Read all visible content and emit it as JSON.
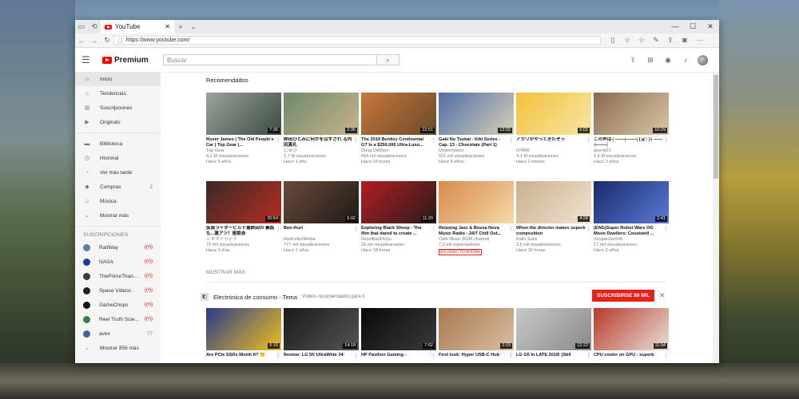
{
  "browser": {
    "tab_title": "YouTube",
    "url": "https://www.youtube.com/"
  },
  "masthead": {
    "logo_text": "Premium",
    "search_placeholder": "Buscar"
  },
  "sidebar": {
    "main_items": [
      {
        "label": "Inicio",
        "icon": "home-icon",
        "glyph": "⌂"
      },
      {
        "label": "Tendencias",
        "icon": "flame-icon",
        "glyph": "♨"
      },
      {
        "label": "Suscripciones",
        "icon": "subscriptions-icon",
        "glyph": "▤"
      },
      {
        "label": "Originals",
        "icon": "originals-icon",
        "glyph": "▶"
      }
    ],
    "library_items": [
      {
        "label": "Biblioteca",
        "icon": "folder-icon",
        "glyph": "▬",
        "count": ""
      },
      {
        "label": "Historial",
        "icon": "history-icon",
        "glyph": "◷",
        "count": ""
      },
      {
        "label": "Ver más tarde",
        "icon": "watch-later-icon",
        "glyph": "◔",
        "count": ""
      },
      {
        "label": "Compras",
        "icon": "tag-icon",
        "glyph": "◆",
        "count": "2"
      },
      {
        "label": "Música",
        "icon": "music-icon",
        "glyph": "♫",
        "count": ""
      },
      {
        "label": "Mostrar más",
        "icon": "chevron-down-icon",
        "glyph": "⌄",
        "count": ""
      }
    ],
    "subs_heading": "SUSCRIPCIONES",
    "subscriptions": [
      {
        "label": "RailWay",
        "right": "((•))",
        "color": "#5b7ea5"
      },
      {
        "label": "NASA",
        "right": "((•))",
        "color": "#1d3f8a"
      },
      {
        "label": "ThePrimeThan...",
        "right": "((•))",
        "color": "#3a3a3a"
      },
      {
        "label": "Space Videos",
        "right": "((•))",
        "color": "#222222"
      },
      {
        "label": "GameChops",
        "right": "((•))",
        "color": "#111111"
      },
      {
        "label": "Reel Truth Scie...",
        "right": "((•))",
        "color": "#3e7d4a"
      },
      {
        "label": "avex",
        "right": "77",
        "color": "#4a5fa0"
      }
    ],
    "show_more_subs": "Mostrar 856 más"
  },
  "main": {
    "recommended_title": "Recomendados",
    "row1": [
      {
        "title": "Rover James | The Old People's Car | Top Gear |...",
        "channel": "Top Gear",
        "views": "6,2 M visualizaciones",
        "age": "Hace 5 años",
        "duration": "7:36",
        "c1": "#9aa39b",
        "c2": "#3e4a44"
      },
      {
        "title": "姉田ひとみに何かをはずされ る内田真礼",
        "channel": "じゅび",
        "views": "1,7 M visualizaciones",
        "age": "Hace 1 año",
        "duration": "2:36",
        "c1": "#6d8a6a",
        "c2": "#c9b38c"
      },
      {
        "title": "The 2019 Bentley Continental GT Is a $250,000 Ultra-Luxu...",
        "channel": "Doug DeMuro",
        "views": "664 mil visualizaciones",
        "age": "Hace 19 horas",
        "duration": "23:51",
        "c1": "#c7773c",
        "c2": "#6b4a2a"
      },
      {
        "title": "Gaki No Tsukai - Kiki Series - Cap. 13 - Chocolate (Part 1)",
        "channel": "Undertowers",
        "views": "621 mil visualizaciones",
        "age": "Hace 5 años",
        "duration": "13:02",
        "c1": "#4d6fa8",
        "c2": "#d9d0b4"
      },
      {
        "title": "アカリがやってきたぞっ",
        "channel": "OYARI",
        "views": "4,1 M visualizaciones",
        "age": "Hace 2 meses",
        "duration": "5:02",
        "c1": "#f2c13a",
        "c2": "#f7e7a4"
      },
      {
        "title": "この声は┤——┼——┤( ゚д゚ )┤——┼——┤",
        "channel": "gromit21",
        "views": "2,6 M visualizaciones",
        "age": "Hace 3 años",
        "duration": "10:29",
        "c1": "#8b6a52",
        "c2": "#d8c6a4"
      }
    ],
    "row2": [
      {
        "title": "仮面ライダービルド最終回の 裏話も...激アツ！座談会",
        "channel": "シネマトゥデイ",
        "views": "72 mil visualizaciones",
        "age": "Hace 3 días",
        "duration": "20:54",
        "c1": "#3a2a28",
        "c2": "#b42d1e",
        "live": false
      },
      {
        "title": "Ben-Hurt",
        "channel": "RedLetterMedia",
        "views": "777 mil visualizaciones",
        "age": "Hace 2 años",
        "duration": "6:02",
        "c1": "#6a4b3a",
        "c2": "#1e1a18",
        "live": false
      },
      {
        "title": "Exploring Black Sheep - The film that dared to create ...",
        "channel": "GoodBadFlicks",
        "views": "26 mil visualizaciones",
        "age": "Hace 18 horas",
        "duration": "11:20",
        "c1": "#b01f24",
        "c2": "#2a1a1a",
        "live": false
      },
      {
        "title": "Relaxing Jazz & Bossa Nova Music Radio - 24/7 Chill Out...",
        "channel": "Cafe Music BGM channel",
        "views": "7,2 mil espectadores",
        "age": "",
        "duration": "",
        "c1": "#d98a4c",
        "c2": "#f4d9a8",
        "live": true,
        "live_label": "EN DIRECTO AHORA"
      },
      {
        "title": "When the director makes superb composition",
        "channel": "Kaiki Subs",
        "views": "2,5 mil visualizaciones",
        "age": "Hace 16 horas",
        "duration": "4:24",
        "c1": "#c9b090",
        "c2": "#f1e3cf",
        "live": false
      },
      {
        "title": "(ENG)Super Robot Wars OG Moon Dwellers: Coustwell ...",
        "channel": "ZengarZenvolt",
        "views": "17 mil visualizaciones",
        "age": "Hace 2 años",
        "duration": "2:41",
        "c1": "#1a2a6a",
        "c2": "#5a7ad8",
        "live": false
      }
    ],
    "show_more": "MOSTRAR MÁS",
    "shelf": {
      "title": "Electrónica de consumo - Tema",
      "subtitle": "Vídeos recomendados para ti",
      "subscribe_label": "SUSCRIBIRSE  86 MIL"
    },
    "row3": [
      {
        "title": "Are PCIe SSDs Worth It? 🤔",
        "duration": "6:16",
        "c1": "#2a3a8a",
        "c2": "#f0c020"
      },
      {
        "title": "Review: LG 5K UltraWide 34-",
        "duration": "14:18",
        "c1": "#1a1a1a",
        "c2": "#555555"
      },
      {
        "title": "HP Pavilion Gaming -",
        "duration": "7:02",
        "c1": "#0a0a0a",
        "c2": "#3a3a3a"
      },
      {
        "title": "First look: Hyper USB-C Hub",
        "duration": "3:19",
        "c1": "#a87850",
        "c2": "#d9c0a0"
      },
      {
        "title": "LG G5 In LATE 2018! (Still",
        "duration": "12:22",
        "c1": "#c8c8c8",
        "c2": "#8a8a8a"
      },
      {
        "title": "CPU cooler on GPU - superb",
        "duration": "11:04",
        "c1": "#b83a2a",
        "c2": "#e8e0d8"
      }
    ]
  }
}
